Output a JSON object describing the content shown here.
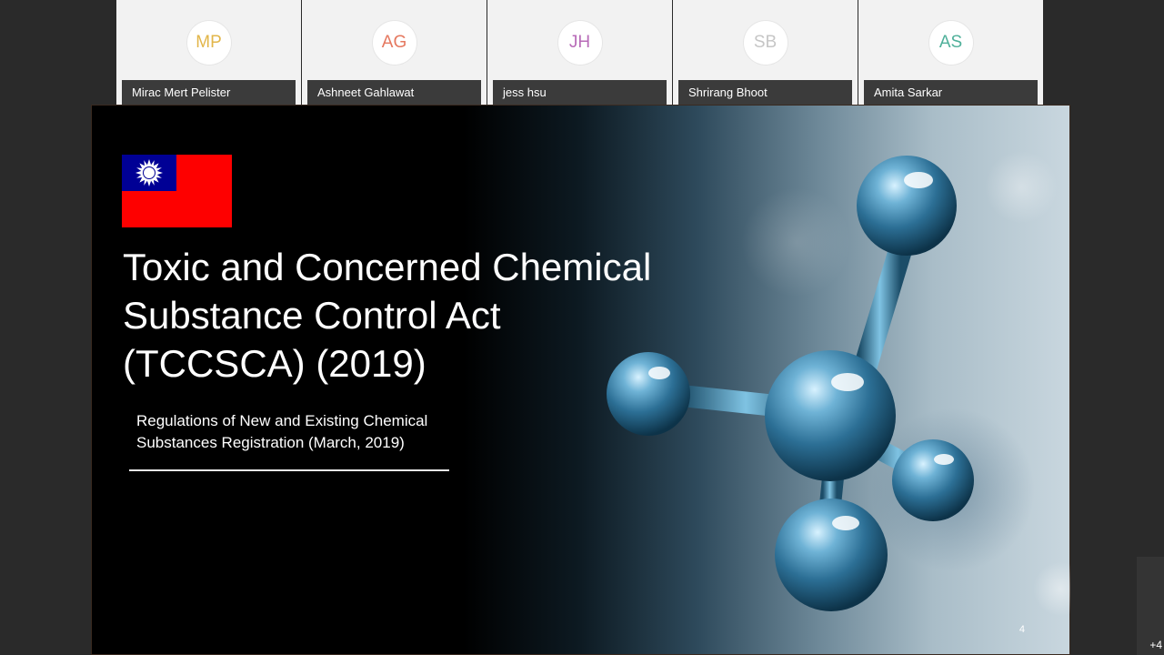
{
  "participants": [
    {
      "initials": "MP",
      "name": "Mirac Mert Pelister",
      "color": "#e2b64a"
    },
    {
      "initials": "AG",
      "name": "Ashneet Gahlawat",
      "color": "#e5785f"
    },
    {
      "initials": "JH",
      "name": "jess hsu",
      "color": "#b86bb8"
    },
    {
      "initials": "SB",
      "name": "Shrirang Bhoot",
      "color": "#c6c6c6"
    },
    {
      "initials": "AS",
      "name": "Amita Sarkar",
      "color": "#4fb09a"
    }
  ],
  "slide": {
    "title": "Toxic and Concerned Chemical Substance Control Act (TCCSCA) (2019)",
    "subtitle": "Regulations of New and Existing Chemical Substances Registration (March, 2019)",
    "page_number": "4",
    "flag_icon": "taiwan-flag-icon",
    "image_icon": "molecule-illustration"
  },
  "overflow": {
    "count_label": "+4"
  }
}
